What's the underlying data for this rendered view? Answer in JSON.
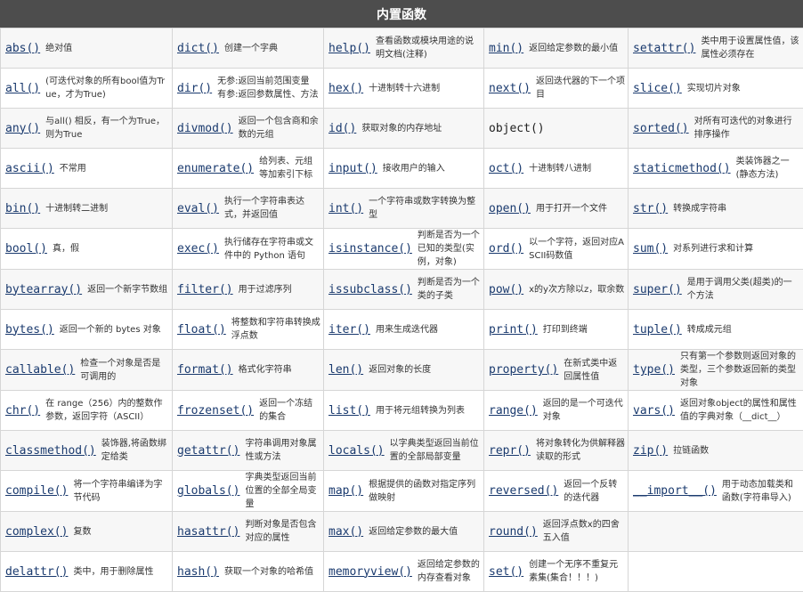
{
  "title": "内置函数",
  "rows": [
    [
      {
        "fn": "abs()",
        "desc": "绝对值"
      },
      {
        "fn": "dict()",
        "desc": "创建一个字典"
      },
      {
        "fn": "help()",
        "desc": "查看函数或模块用途的说明文档(注释)"
      },
      {
        "fn": "min()",
        "desc": "返回给定参数的最小值"
      },
      {
        "fn": "setattr()",
        "desc": "类中用于设置属性值，该属性必须存在"
      }
    ],
    [
      {
        "fn": "all()",
        "desc": "(可迭代对象的所有bool值为True，才为True)"
      },
      {
        "fn": "dir()",
        "desc": "无参:返回当前范围变量 有参:返回参数属性、方法"
      },
      {
        "fn": "hex()",
        "desc": "十进制转十六进制"
      },
      {
        "fn": "next()",
        "desc": "返回迭代器的下一个项目"
      },
      {
        "fn": "slice()",
        "desc": "实现切片对象"
      }
    ],
    [
      {
        "fn": "any()",
        "desc": "与all() 相反，有一个为True，则为True"
      },
      {
        "fn": "divmod()",
        "desc": "返回一个包含商和余数的元组"
      },
      {
        "fn": "id()",
        "desc": "获取对象的内存地址"
      },
      {
        "fn": "object()",
        "desc": "",
        "plain": true
      },
      {
        "fn": "sorted()",
        "desc": "对所有可迭代的对象进行排序操作"
      }
    ],
    [
      {
        "fn": "ascii()",
        "desc": "不常用"
      },
      {
        "fn": "enumerate()",
        "desc": "给列表、元组等加索引下标"
      },
      {
        "fn": "input()",
        "desc": "接收用户的输入"
      },
      {
        "fn": "oct()",
        "desc": "十进制转八进制"
      },
      {
        "fn": "staticmethod()",
        "desc": "类装饰器之一(静态方法)"
      }
    ],
    [
      {
        "fn": "bin()",
        "desc": "十进制转二进制"
      },
      {
        "fn": "eval()",
        "desc": "执行一个字符串表达式，并返回值"
      },
      {
        "fn": "int()",
        "desc": "一个字符串或数字转换为整型"
      },
      {
        "fn": "open()",
        "desc": "用于打开一个文件"
      },
      {
        "fn": "str()",
        "desc": "转换成字符串"
      }
    ],
    [
      {
        "fn": "bool()",
        "desc": "真，假"
      },
      {
        "fn": "exec()",
        "desc": "执行储存在字符串或文件中的 Python 语句"
      },
      {
        "fn": "isinstance()",
        "desc": "判断是否为一个已知的类型(实例，对象)"
      },
      {
        "fn": "ord()",
        "desc": "以一个字符，返回对应ASCII码数值"
      },
      {
        "fn": "sum()",
        "desc": "对系列进行求和计算"
      }
    ],
    [
      {
        "fn": "bytearray()",
        "desc": "返回一个新字节数组"
      },
      {
        "fn": "filter()",
        "desc": "用于过滤序列"
      },
      {
        "fn": "issubclass()",
        "desc": "判断是否为一个类的子类"
      },
      {
        "fn": "pow()",
        "desc": "x的y次方除以z，取余数"
      },
      {
        "fn": "super()",
        "desc": "是用于调用父类(超类)的一个方法"
      }
    ],
    [
      {
        "fn": "bytes()",
        "desc": "返回一个新的 bytes 对象"
      },
      {
        "fn": "float()",
        "desc": "将整数和字符串转换成浮点数"
      },
      {
        "fn": "iter()",
        "desc": "用来生成迭代器"
      },
      {
        "fn": "print()",
        "desc": "打印到终端"
      },
      {
        "fn": "tuple()",
        "desc": "转成成元组"
      }
    ],
    [
      {
        "fn": "callable()",
        "desc": "检查一个对象是否是可调用的"
      },
      {
        "fn": "format()",
        "desc": "格式化字符串"
      },
      {
        "fn": "len()",
        "desc": "返回对象的长度"
      },
      {
        "fn": "property()",
        "desc": "在新式类中返回属性值"
      },
      {
        "fn": "type()",
        "desc": "只有第一个参数则返回对象的类型，三个参数返回新的类型对象"
      }
    ],
    [
      {
        "fn": "chr()",
        "desc": "在 range（256）内的整数作参数，返回字符（ASCII）"
      },
      {
        "fn": "frozenset()",
        "desc": "返回一个冻结的集合"
      },
      {
        "fn": "list()",
        "desc": "用于将元组转换为列表"
      },
      {
        "fn": "range()",
        "desc": "返回的是一个可迭代对象"
      },
      {
        "fn": "vars()",
        "desc": "返回对象object的属性和属性值的字典对象（__dict__）"
      }
    ],
    [
      {
        "fn": "classmethod()",
        "desc": "装饰器,将函数绑定给类"
      },
      {
        "fn": "getattr()",
        "desc": "字符串调用对象属性或方法"
      },
      {
        "fn": "locals()",
        "desc": "以字典类型返回当前位置的全部局部变量"
      },
      {
        "fn": "repr()",
        "desc": "将对象转化为供解释器读取的形式"
      },
      {
        "fn": "zip()",
        "desc": "拉链函数"
      }
    ],
    [
      {
        "fn": "compile()",
        "desc": "将一个字符串编译为字节代码"
      },
      {
        "fn": "globals()",
        "desc": "字典类型返回当前位置的全部全局变量"
      },
      {
        "fn": "map()",
        "desc": "根据提供的函数对指定序列做映射"
      },
      {
        "fn": "reversed()",
        "desc": "返回一个反转的迭代器"
      },
      {
        "fn": "__import__()",
        "desc": "用于动态加载类和函数(字符串导入)"
      }
    ],
    [
      {
        "fn": "complex()",
        "desc": "复数"
      },
      {
        "fn": "hasattr()",
        "desc": "判断对象是否包含对应的属性"
      },
      {
        "fn": "max()",
        "desc": "返回给定参数的最大值"
      },
      {
        "fn": "round()",
        "desc": "返回浮点数x的四舍五入值"
      },
      {
        "fn": "",
        "desc": ""
      }
    ],
    [
      {
        "fn": "delattr()",
        "desc": "类中，用于删除属性"
      },
      {
        "fn": "hash()",
        "desc": "获取一个对象的哈希值"
      },
      {
        "fn": "memoryview()",
        "desc": "返回给定参数的内存查看对象"
      },
      {
        "fn": "set()",
        "desc": "创建一个无序不重复元素集(集合！！！)"
      },
      {
        "fn": "",
        "desc": ""
      }
    ]
  ]
}
